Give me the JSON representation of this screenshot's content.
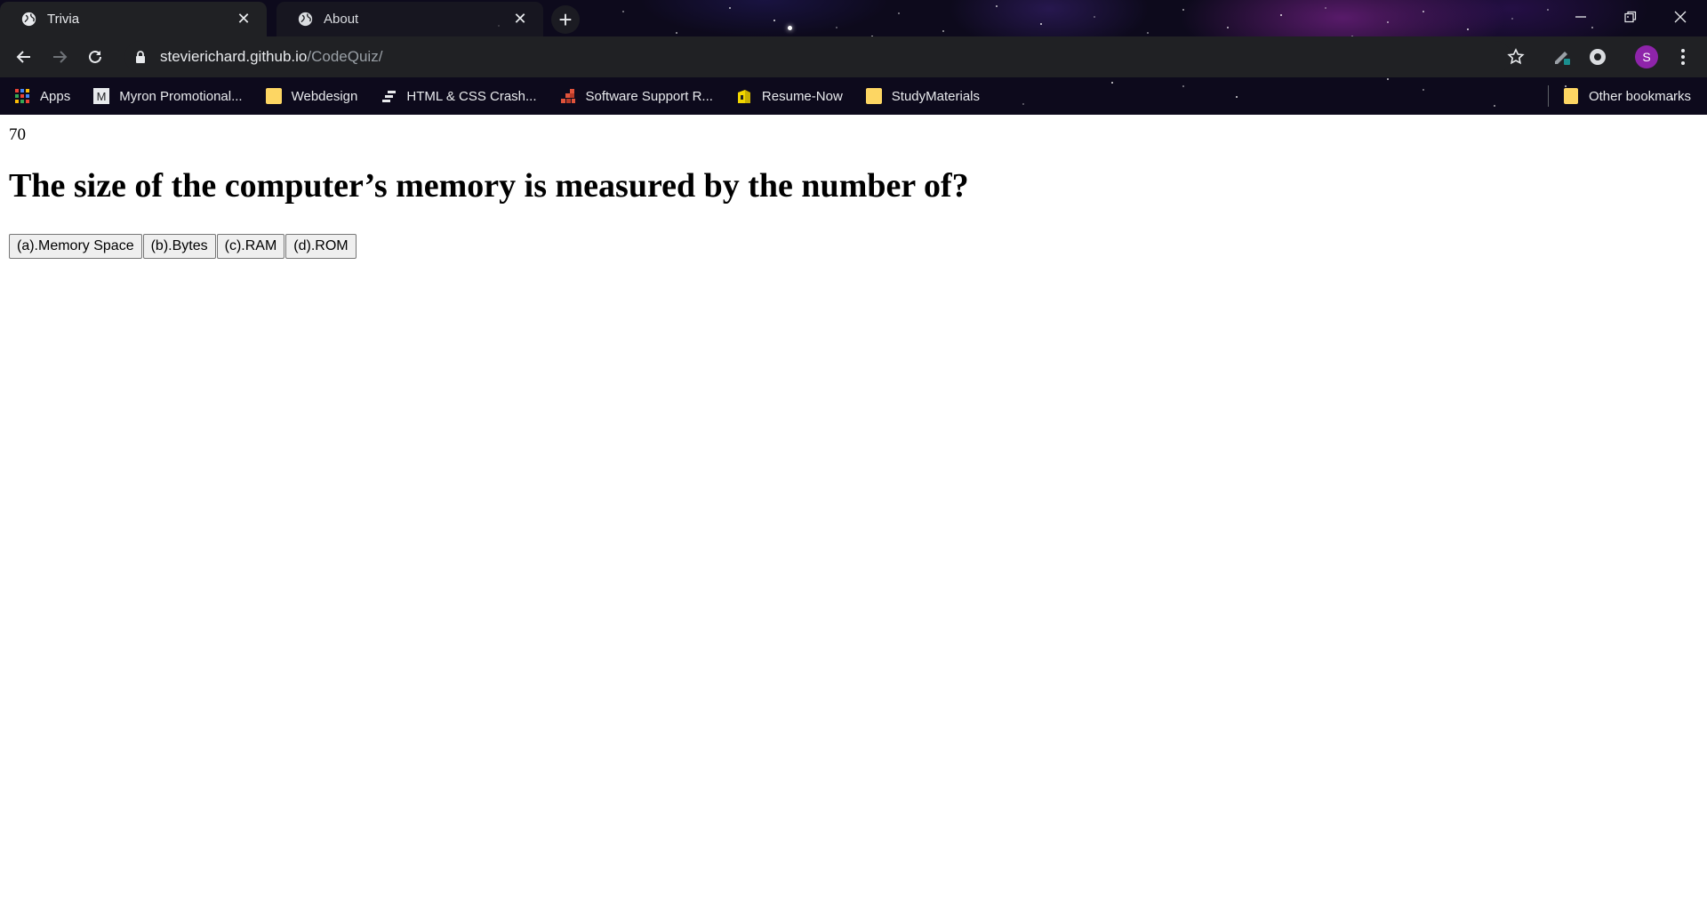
{
  "browser": {
    "tabs": [
      {
        "title": "Trivia",
        "active": true
      },
      {
        "title": "About",
        "active": false
      }
    ],
    "address": {
      "host": "stevierichard.github.io",
      "path": "/CodeQuiz/"
    },
    "profile_initial": "S",
    "bookmarks": [
      {
        "label": "Apps",
        "icon": "apps-grid-icon"
      },
      {
        "label": "Myron Promotional...",
        "icon": "myron-m-icon"
      },
      {
        "label": "Webdesign",
        "icon": "folder-icon"
      },
      {
        "label": "HTML & CSS Crash...",
        "icon": "bars-icon"
      },
      {
        "label": "Software Support R...",
        "icon": "blocks-icon"
      },
      {
        "label": "Resume-Now",
        "icon": "resume-now-icon"
      },
      {
        "label": "StudyMaterials",
        "icon": "folder-icon"
      }
    ],
    "other_bookmarks": "Other bookmarks"
  },
  "quiz": {
    "timer": "70",
    "question": "The size of the computer’s memory is measured by the number of?",
    "choices": [
      "(a).Memory Space",
      "(b).Bytes",
      "(c).RAM",
      "(d).ROM"
    ]
  },
  "colors": {
    "chrome_dark": "#202124",
    "folder": "#fdd663",
    "avatar": "#8e24aa"
  }
}
